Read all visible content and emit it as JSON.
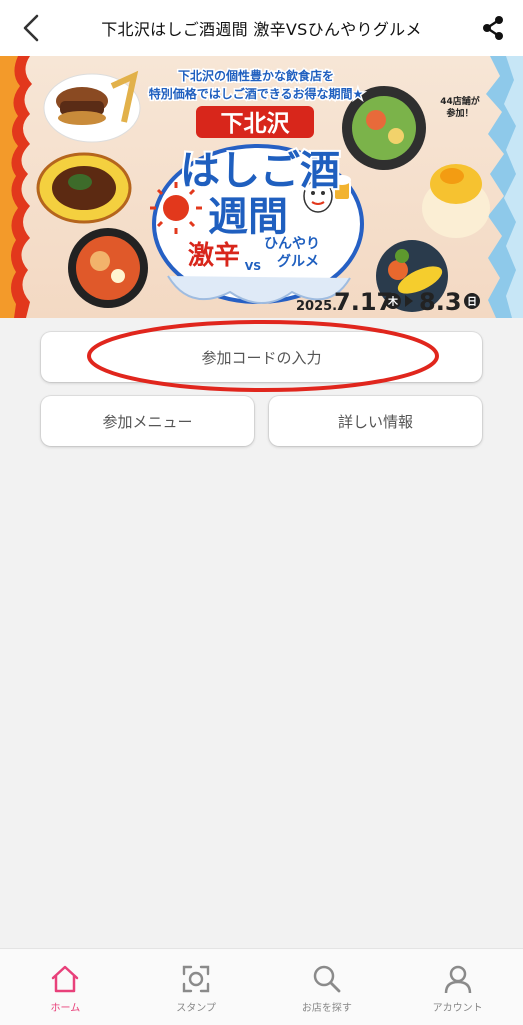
{
  "header": {
    "title": "下北沢はしご酒週間 激辛VSひんやりグルメ",
    "back_icon": "chevron-left-icon",
    "share_icon": "share-icon"
  },
  "banner": {
    "lead_line1": "下北沢の個性豊かな飲食店を",
    "lead_line2": "特別価格ではしご酒できるお得な期間★",
    "area": "下北沢",
    "title_line1": "はしご酒",
    "title_line2": "週間",
    "spicy": "激辛",
    "vs": "VS",
    "cool_line1": "ひんやり",
    "cool_line2": "グルメ",
    "shops_line1": "44店舗が",
    "shops_line2": "参加！",
    "year": "2025.",
    "start": "7.17",
    "start_day": "木",
    "end": "8.3",
    "end_day": "日"
  },
  "buttons": {
    "code_entry": "参加コードの入力",
    "menu": "参加メニュー",
    "info": "詳しい情報"
  },
  "tabbar": {
    "items": [
      {
        "label": "ホーム",
        "icon": "home-icon",
        "active": true
      },
      {
        "label": "スタンプ",
        "icon": "stamp-scan-icon",
        "active": false
      },
      {
        "label": "お店を探す",
        "icon": "search-icon",
        "active": false
      },
      {
        "label": "アカウント",
        "icon": "account-icon",
        "active": false
      }
    ]
  },
  "colors": {
    "accent": "#e8407a",
    "annotation_red": "#e0261d",
    "banner_red": "#d8261b",
    "banner_blue": "#1f5fbf"
  }
}
